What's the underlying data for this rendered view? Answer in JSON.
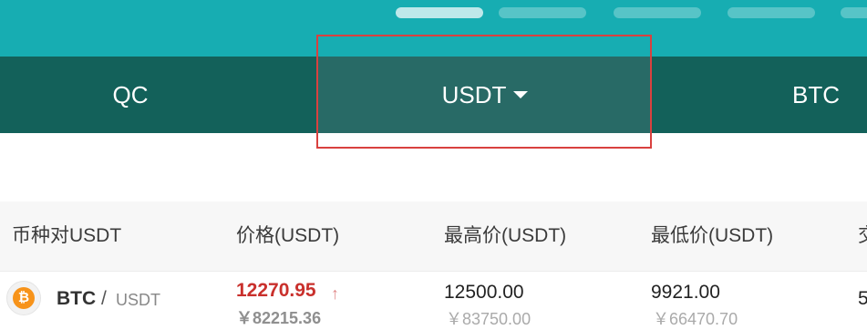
{
  "tabs": [
    {
      "label": "QC"
    },
    {
      "label": "USDT",
      "active": true
    },
    {
      "label": "BTC"
    }
  ],
  "table": {
    "headers": [
      "币种对USDT",
      "价格(USDT)",
      "最高价(USDT)",
      "最低价(USDT)",
      "交"
    ],
    "rows": [
      {
        "coin_icon": "bitcoin-icon",
        "base": "BTC",
        "sep": "/",
        "quote": "USDT",
        "price": "12270.95",
        "price_trend": "↑",
        "price_cny": "￥82215.36",
        "high": "12500.00",
        "high_cny": "￥83750.00",
        "low": "9921.00",
        "low_cny": "￥66470.70",
        "volume": "5"
      }
    ]
  },
  "colors": {
    "banner": "#17adb2",
    "tabbar": "#13615a",
    "active_tab": "#286a66",
    "highlight_border": "#d9413f",
    "price_up": "#c9302c"
  }
}
